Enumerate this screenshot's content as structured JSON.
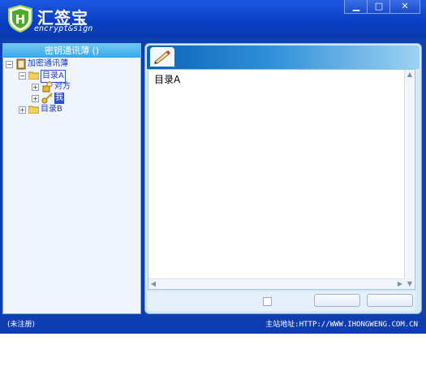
{
  "app": {
    "title": "汇签宝",
    "subtitle": "encrypt&sign",
    "window_buttons": {
      "minimize": "▁",
      "maximize": "□",
      "close": "✕"
    }
  },
  "left_panel": {
    "header": "密钥通讯薄 ()",
    "tree": {
      "root": {
        "label": "加密通讯薄",
        "expander": "−",
        "icon": "address-book-icon"
      },
      "dir_a": {
        "label": "目录A",
        "expander": "−",
        "icon": "folder-icon"
      },
      "contact_peer": {
        "label": "对方",
        "expander": "+",
        "icon": "key-lock-icon"
      },
      "contact_me": {
        "label": "我",
        "expander": "+",
        "icon": "key-icon"
      },
      "dir_b": {
        "label": "目录B",
        "expander": "+",
        "icon": "folder-icon"
      }
    }
  },
  "right_panel": {
    "tab_icon": "pen-icon",
    "content_title": "目录A",
    "checkbox_checked": false,
    "button1_label": "",
    "button2_label": ""
  },
  "status_bar": {
    "left": "(未注册)",
    "right": "主站地址:HTTP://WWW.IHONGWENG.COM.CN"
  },
  "colors": {
    "title_bar": "#0a40c8",
    "accent": "#3aa6e6",
    "status_bar": "#0d3db0"
  }
}
